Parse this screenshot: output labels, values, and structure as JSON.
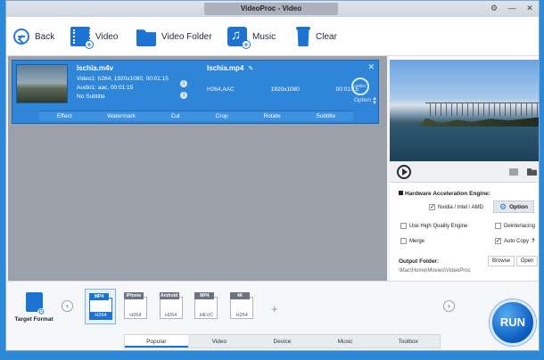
{
  "window": {
    "title": "VideoProc - Video"
  },
  "toolbar": {
    "back": "Back",
    "video": "Video",
    "video_folder": "Video Folder",
    "music": "Music",
    "clear": "Clear"
  },
  "file": {
    "source_name": "Ischia.m4v",
    "video_info": "Video1: h264, 1920x1080, 00:01:15",
    "audio_info": "Audio1: aac, 00:01:15",
    "subtitle_info": "No Subtitle",
    "output_name": "Ischia.mp4",
    "output_codec": "H264,AAC",
    "output_resolution": "1920x1080",
    "output_duration": "00:01:15",
    "codec_label": "Option"
  },
  "edit_tools": [
    "Effect",
    "Watermark",
    "Cut",
    "Crop",
    "Rotate",
    "Subtitle"
  ],
  "settings": {
    "hw_title": "Hardware Acceleration Engine:",
    "gpu_option": "Nvidia / Intel / AMD",
    "option_button": "Option",
    "high_quality": "Use High Quality Engine",
    "deinterlacing": "Deinterlacing",
    "merge": "Merge",
    "auto_copy": "Auto Copy",
    "help": "?",
    "output_folder": "Output Folder:",
    "browse": "Browse",
    "open": "Open",
    "output_path": "\\Mac\\Home\\Movies\\VideoProc"
  },
  "format": {
    "target_label": "Target Format",
    "items": [
      {
        "tag": "MP4",
        "codec": "H264"
      },
      {
        "tag": "iPhone",
        "codec": "H264"
      },
      {
        "tag": "Android",
        "codec": "H264"
      },
      {
        "tag": "MP4",
        "codec": "HEVC"
      },
      {
        "tag": "4K",
        "codec": "H264"
      }
    ]
  },
  "tabs": [
    "Popular",
    "Video",
    "Device",
    "Music",
    "Toolbox"
  ],
  "run": "RUN"
}
